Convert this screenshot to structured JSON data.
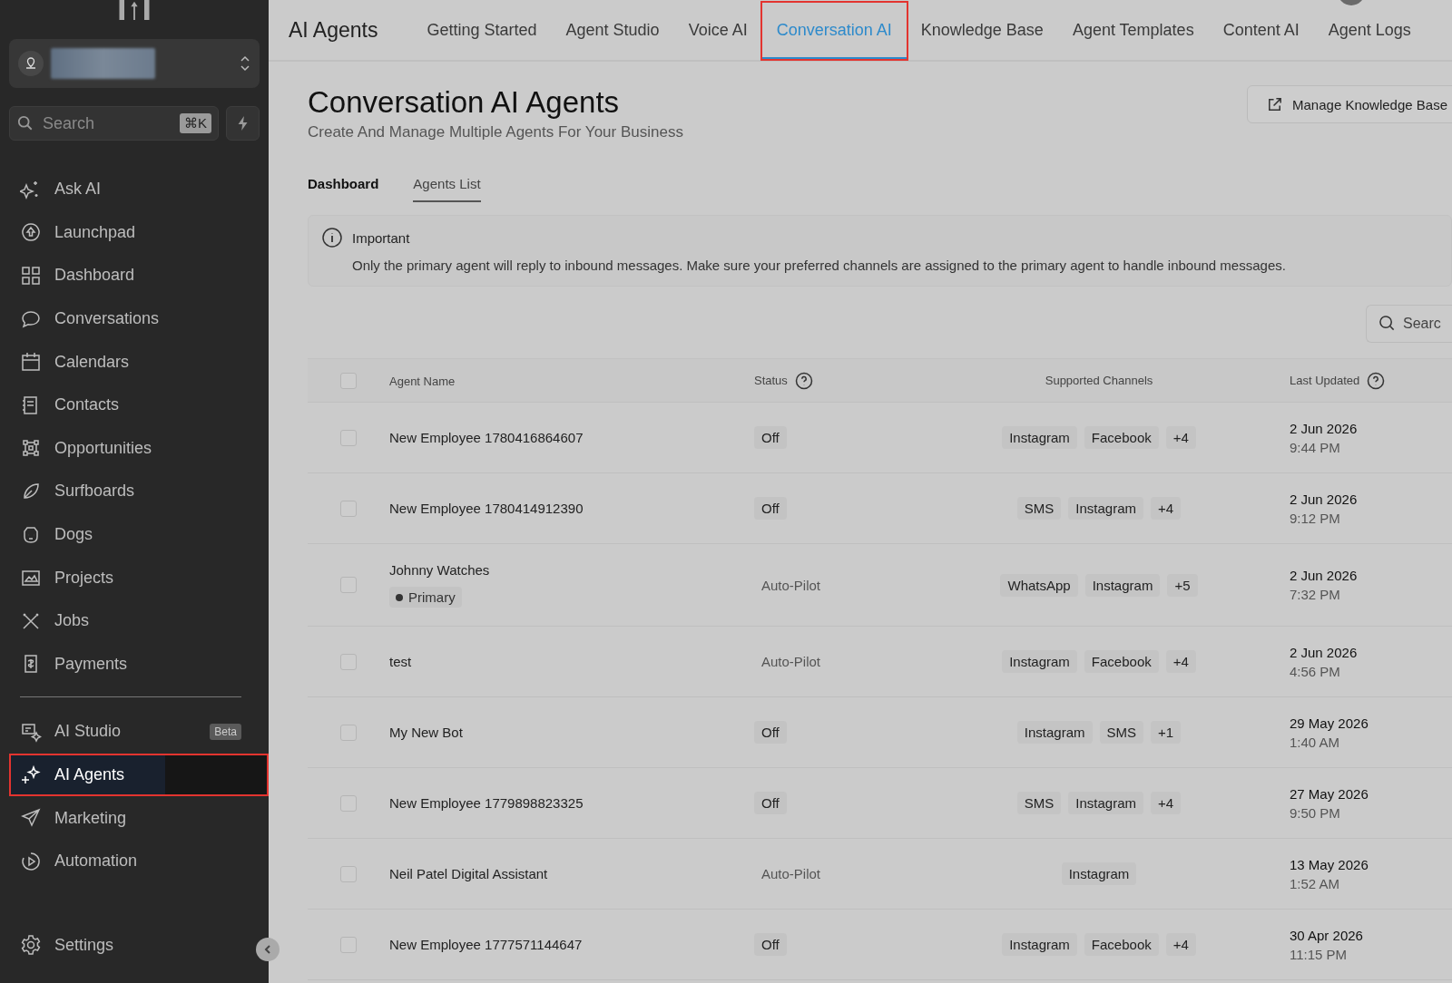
{
  "sidebar": {
    "search": {
      "placeholder": "Search",
      "shortcut": "⌘K"
    },
    "nav": [
      {
        "label": "Ask AI",
        "selected": false,
        "highlighted": false
      },
      {
        "label": "Launchpad",
        "selected": false,
        "highlighted": false
      },
      {
        "label": "Dashboard",
        "selected": false,
        "highlighted": false
      },
      {
        "label": "Conversations",
        "selected": false,
        "highlighted": false
      },
      {
        "label": "Calendars",
        "selected": false,
        "highlighted": false
      },
      {
        "label": "Contacts",
        "selected": false,
        "highlighted": false
      },
      {
        "label": "Opportunities",
        "selected": false,
        "highlighted": false
      },
      {
        "label": "Surfboards",
        "selected": false,
        "highlighted": false
      },
      {
        "label": "Dogs",
        "selected": false,
        "highlighted": false
      },
      {
        "label": "Projects",
        "selected": false,
        "highlighted": false
      },
      {
        "label": "Jobs",
        "selected": false,
        "highlighted": false
      },
      {
        "label": "Payments",
        "selected": false,
        "highlighted": false
      }
    ],
    "nav2": [
      {
        "label": "AI Studio",
        "badge": "Beta",
        "selected": false,
        "highlighted": false
      },
      {
        "label": "AI Agents",
        "selected": true,
        "highlighted": true
      },
      {
        "label": "Marketing",
        "selected": false,
        "highlighted": false
      },
      {
        "label": "Automation",
        "selected": false,
        "highlighted": false
      }
    ],
    "settings": "Settings"
  },
  "topbar": {
    "title": "AI Agents",
    "tabs": [
      {
        "label": "Getting Started",
        "selected": false,
        "highlighted": false
      },
      {
        "label": "Agent Studio",
        "selected": false,
        "highlighted": false
      },
      {
        "label": "Voice AI",
        "selected": false,
        "highlighted": false
      },
      {
        "label": "Conversation AI",
        "selected": true,
        "highlighted": true
      },
      {
        "label": "Knowledge Base",
        "selected": false,
        "highlighted": false
      },
      {
        "label": "Agent Templates",
        "selected": false,
        "highlighted": false
      },
      {
        "label": "Content AI",
        "selected": false,
        "highlighted": false
      },
      {
        "label": "Agent Logs",
        "selected": false,
        "highlighted": false
      }
    ]
  },
  "page": {
    "title": "Conversation AI Agents",
    "subtitle": "Create And Manage Multiple Agents For Your Business",
    "action": "Manage Knowledge Base",
    "subtabs": [
      {
        "label": "Dashboard",
        "selected": false
      },
      {
        "label": "Agents List",
        "selected": true
      }
    ],
    "notice": {
      "title": "Important",
      "text": "Only the primary agent will reply to inbound messages. Make sure your preferred channels are assigned to the primary agent to handle inbound messages."
    },
    "search": {
      "placeholder": "Searc"
    }
  },
  "table": {
    "select_all": false,
    "columns": [
      "Agent Name",
      "Status",
      "Supported Channels",
      "Last Updated"
    ],
    "rows": [
      {
        "checked": false,
        "name": "New Employee 1780416864607",
        "status": {
          "text": "Off",
          "kind": "off"
        },
        "channels": [
          "Instagram",
          "Facebook",
          "+4"
        ],
        "date": "2 Jun 2026",
        "time": "9:44 PM"
      },
      {
        "checked": false,
        "name": "New Employee 1780414912390",
        "status": {
          "text": "Off",
          "kind": "off"
        },
        "channels": [
          "SMS",
          "Instagram",
          "+4"
        ],
        "date": "2 Jun 2026",
        "time": "9:12 PM"
      },
      {
        "checked": false,
        "name": "Johnny Watches",
        "primary": "Primary",
        "status": {
          "text": "Auto-Pilot",
          "kind": "auto"
        },
        "channels": [
          "WhatsApp",
          "Instagram",
          "+5"
        ],
        "date": "2 Jun 2026",
        "time": "7:32 PM"
      },
      {
        "checked": false,
        "name": "test",
        "status": {
          "text": "Auto-Pilot",
          "kind": "auto"
        },
        "channels": [
          "Instagram",
          "Facebook",
          "+4"
        ],
        "date": "2 Jun 2026",
        "time": "4:56 PM"
      },
      {
        "checked": false,
        "name": "My New Bot",
        "status": {
          "text": "Off",
          "kind": "off"
        },
        "channels": [
          "Instagram",
          "SMS",
          "+1"
        ],
        "date": "29 May 2026",
        "time": "1:40 AM"
      },
      {
        "checked": false,
        "name": "New Employee 1779898823325",
        "status": {
          "text": "Off",
          "kind": "off"
        },
        "channels": [
          "SMS",
          "Instagram",
          "+4"
        ],
        "date": "27 May 2026",
        "time": "9:50 PM"
      },
      {
        "checked": false,
        "name": "Neil Patel Digital Assistant",
        "status": {
          "text": "Auto-Pilot",
          "kind": "auto"
        },
        "channels": [
          "Instagram"
        ],
        "date": "13 May 2026",
        "time": "1:52 AM"
      },
      {
        "checked": false,
        "name": "New Employee 1777571144647",
        "status": {
          "text": "Off",
          "kind": "off"
        },
        "channels": [
          "Instagram",
          "Facebook",
          "+4"
        ],
        "date": "30 Apr 2026",
        "time": "11:15 PM"
      }
    ]
  }
}
